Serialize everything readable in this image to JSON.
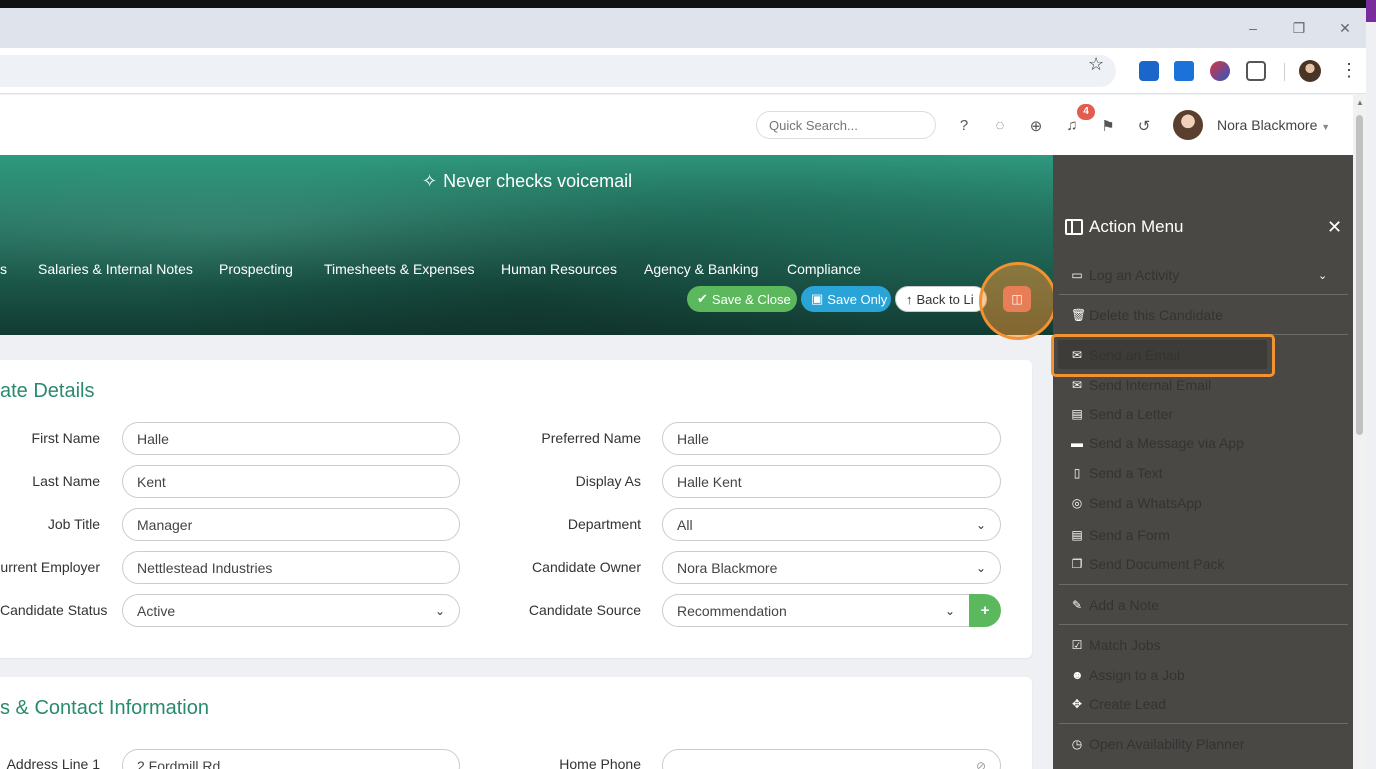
{
  "colors": {
    "accent": "#2a8a6e",
    "save_close": "#5cb85c",
    "save_only": "#2aa3d6",
    "highlight": "#f39230",
    "panel_bg": "#4a4845",
    "badge": "#e25c4f"
  },
  "window": {
    "minimize": "–",
    "restore": "❐",
    "close": "✕"
  },
  "header": {
    "search_placeholder": "Quick Search...",
    "notification_count": "4",
    "user_name": "Nora Blackmore",
    "icons": [
      "help-icon",
      "chat-icon",
      "add-circle-icon",
      "bell-icon",
      "flag-icon",
      "history-icon"
    ]
  },
  "banner": {
    "pinned_note": "Never checks voicemail",
    "tabs": [
      "s",
      "Salaries & Internal Notes",
      "Prospecting",
      "Timesheets & Expenses",
      "Human Resources",
      "Agency & Banking",
      "Compliance"
    ],
    "buttons": {
      "save_close": "Save & Close",
      "save_only": "Save Only",
      "back": "Back to Li"
    }
  },
  "details": {
    "title": "ate Details",
    "fields": {
      "first_name": {
        "label": "First Name",
        "value": "Halle"
      },
      "last_name": {
        "label": "Last Name",
        "value": "Kent"
      },
      "job_title": {
        "label": "Job Title",
        "value": "Manager"
      },
      "current_employer": {
        "label": "urrent Employer",
        "value": "Nettlestead Industries"
      },
      "candidate_status": {
        "label": "Candidate Status",
        "value": "Active"
      },
      "preferred_name": {
        "label": "Preferred Name",
        "value": "Halle"
      },
      "display_as": {
        "label": "Display As",
        "value": "Halle Kent"
      },
      "department": {
        "label": "Department",
        "value": "All"
      },
      "candidate_owner": {
        "label": "Candidate Owner",
        "value": "Nora Blackmore"
      },
      "candidate_source": {
        "label": "Candidate Source",
        "value": "Recommendation"
      }
    }
  },
  "contact": {
    "title": "s & Contact Information",
    "address_line_1": {
      "label": "Address Line 1",
      "value": "2 Fordmill Rd"
    },
    "home_phone": {
      "label": "Home Phone",
      "value": ""
    }
  },
  "action_menu": {
    "title": "Action Menu",
    "close": "✕",
    "items": [
      {
        "label": "Log an Activity",
        "icon": "log-icon"
      },
      {
        "label": "Delete this Candidate",
        "icon": "trash-icon"
      },
      {
        "label": "Send an Email",
        "icon": "envelope-icon"
      },
      {
        "label": "Send Internal Email",
        "icon": "envelope-icon"
      },
      {
        "label": "Send a Letter",
        "icon": "document-icon"
      },
      {
        "label": "Send a Message via App",
        "icon": "message-icon"
      },
      {
        "label": "Send a Text",
        "icon": "mobile-icon"
      },
      {
        "label": "Send a WhatsApp",
        "icon": "whatsapp-icon"
      },
      {
        "label": "Send a Form",
        "icon": "form-icon"
      },
      {
        "label": "Send Document Pack",
        "icon": "documents-icon"
      },
      {
        "label": "Add a Note",
        "icon": "edit-icon"
      },
      {
        "label": "Match Jobs",
        "icon": "check-square-icon"
      },
      {
        "label": "Assign to a Job",
        "icon": "users-icon"
      },
      {
        "label": "Create Lead",
        "icon": "lead-icon"
      },
      {
        "label": "Open Availability Planner",
        "icon": "clock-icon"
      }
    ]
  }
}
